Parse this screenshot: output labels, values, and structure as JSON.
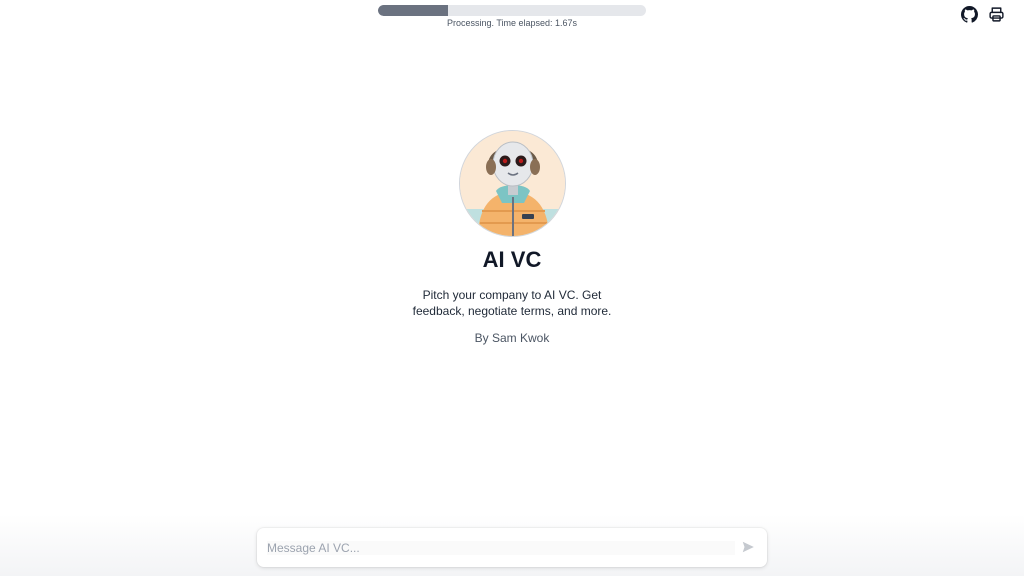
{
  "progress": {
    "fraction": 0.26,
    "text": "Processing. Time elapsed: 1.67s"
  },
  "top_icons": [
    "github-icon",
    "printer-icon"
  ],
  "profile": {
    "title": "AI VC",
    "description": "Pitch your company to AI VC. Get feedback, negotiate terms, and more.",
    "author": "By Sam Kwok"
  },
  "composer": {
    "placeholder": "Message AI VC...",
    "value": "",
    "send_icon": "send-icon"
  },
  "colors": {
    "progress_fill": "#6b7280",
    "progress_track": "#e5e7eb"
  }
}
